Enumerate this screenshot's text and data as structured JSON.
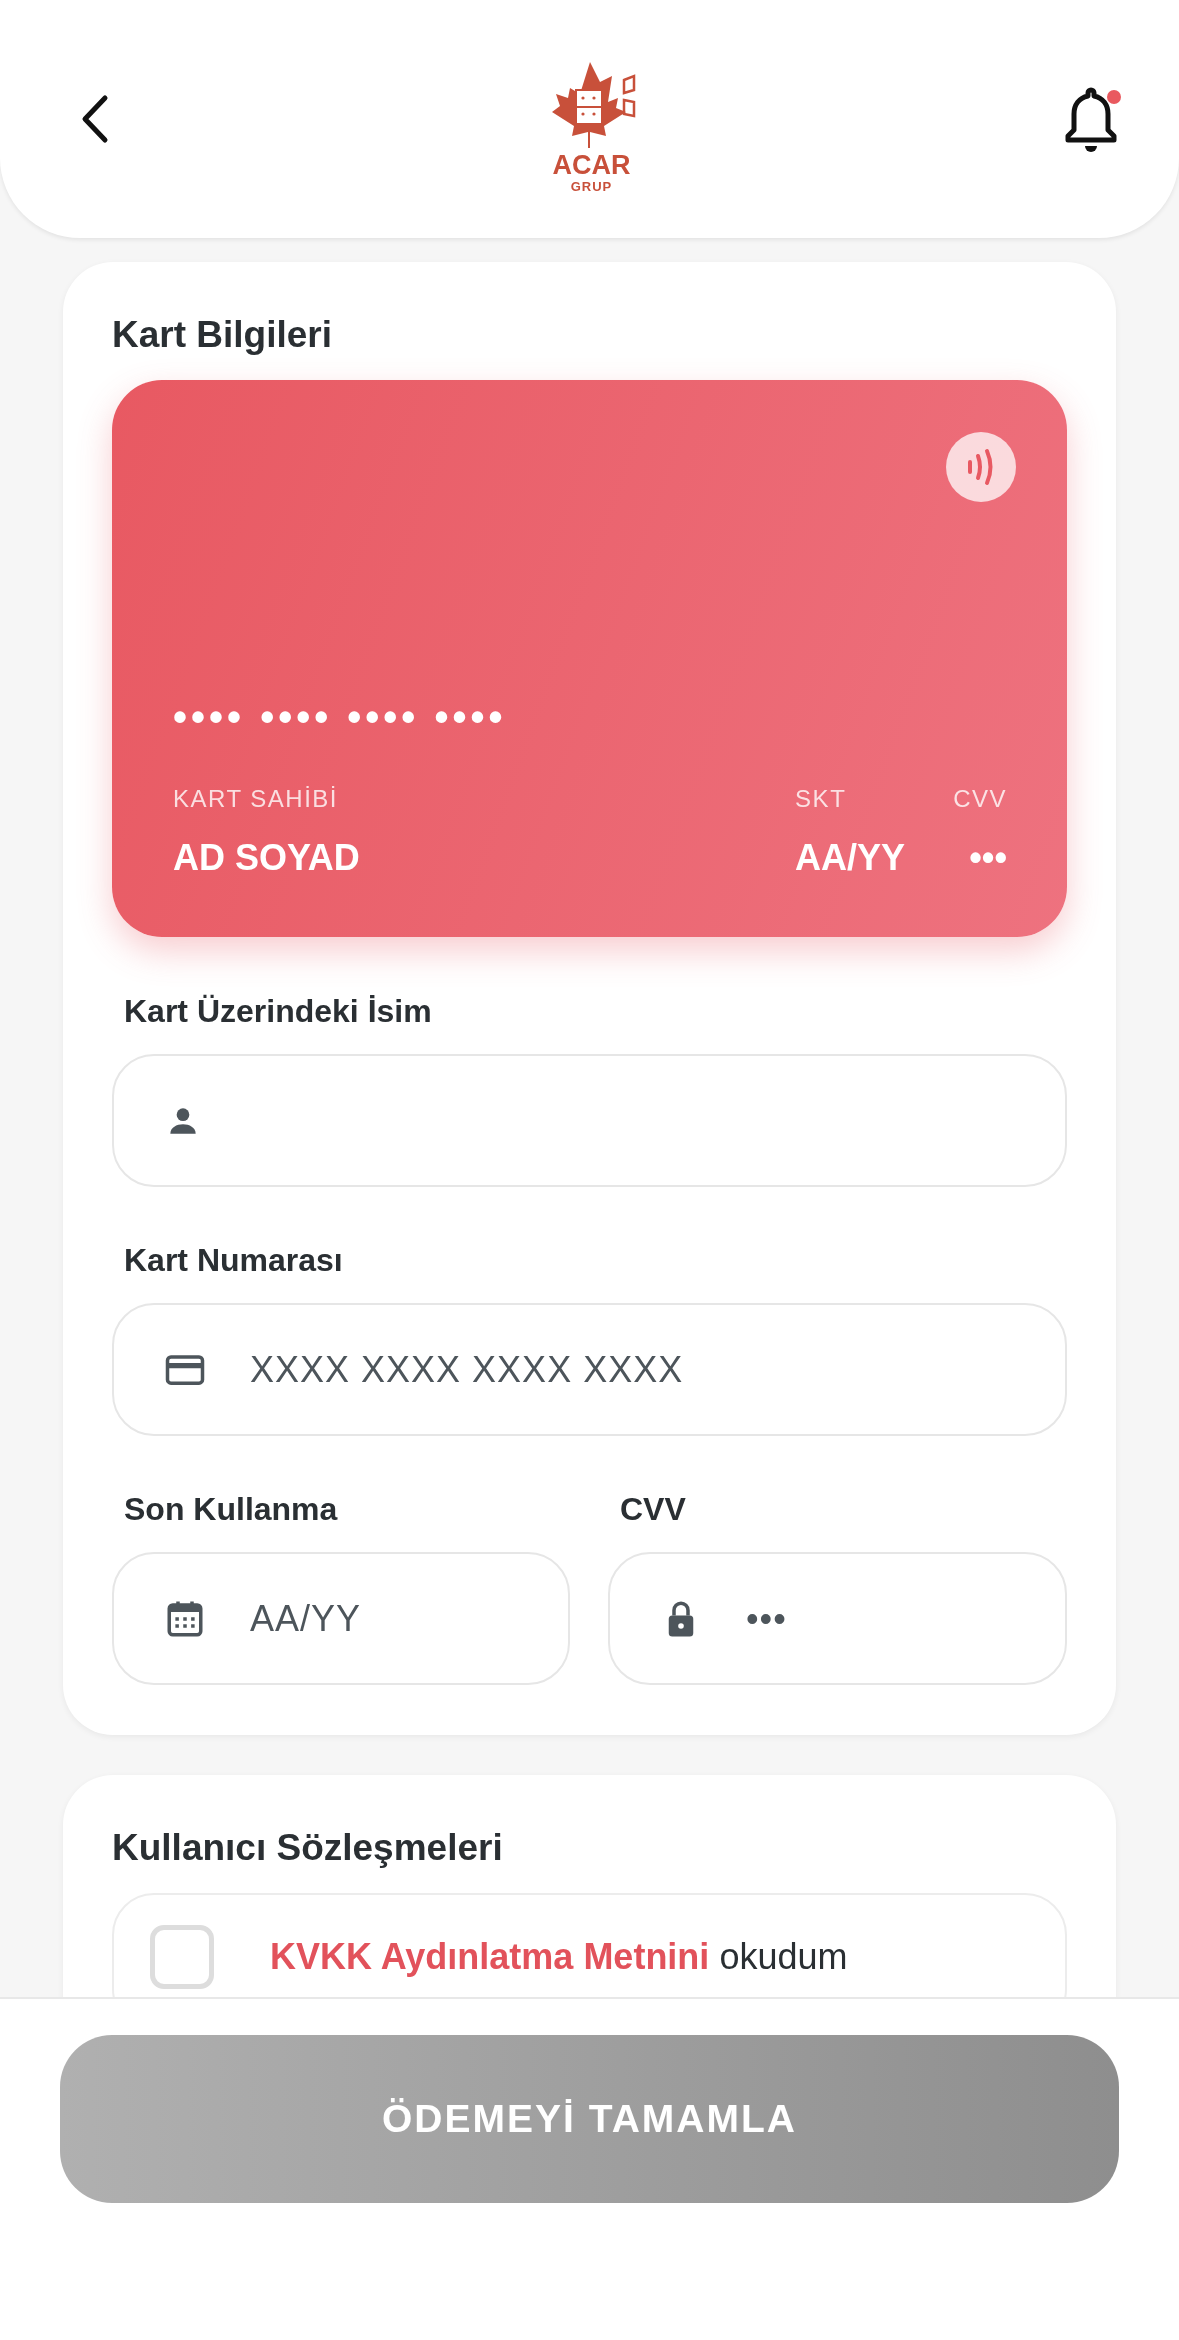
{
  "header": {
    "logo": {
      "name": "ACAR",
      "sub": "GRUP"
    },
    "notifications": {
      "unread": true
    }
  },
  "card_section": {
    "title": "Kart Bilgileri",
    "card_preview": {
      "number": "•••• •••• •••• ••••",
      "holder_label": "KART SAHİBİ",
      "holder": "AD SOYAD",
      "expiry_label": "SKT",
      "expiry": "AA/YY",
      "cvv_label": "CVV",
      "cvv": "•••"
    },
    "fields": [
      {
        "label": "Kart Üzerindeki İsim",
        "kind": "name"
      },
      {
        "label": "Kart Numarası",
        "kind": "number",
        "placeholder": "XXXX XXXX XXXX XXXX"
      }
    ],
    "row_fields": [
      {
        "label": "Son Kullanma",
        "kind": "expiry",
        "placeholder": "AA/YY"
      },
      {
        "label": "CVV",
        "kind": "cvv",
        "placeholder": "•••"
      }
    ]
  },
  "agreements": {
    "title": "Kullanıcı Sözleşmeleri",
    "items": [
      {
        "checked": false,
        "link": "KVKK Aydınlatma Metnini",
        "text": "okudum"
      }
    ]
  },
  "submit": {
    "label": "ÖDEMEYİ TAMAMLA",
    "disabled": true
  }
}
